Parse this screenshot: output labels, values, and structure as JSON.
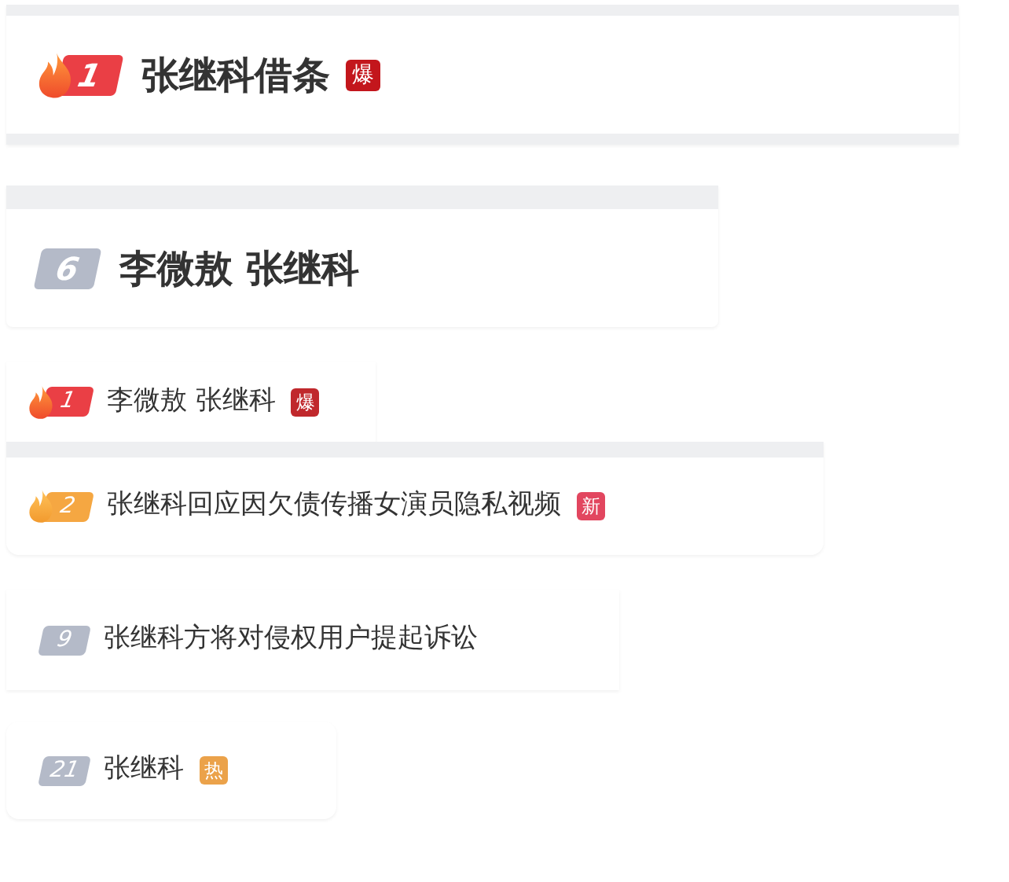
{
  "entries": [
    {
      "kind": "headline",
      "rank": {
        "text": "1",
        "color": "#ea3f45",
        "flame": true
      },
      "title": "张继科借条",
      "tag": {
        "text": "爆",
        "color": "#c3161c"
      }
    },
    {
      "kind": "headline",
      "rank": {
        "text": "6",
        "color": "#b4bac8",
        "flame": false
      },
      "title": "李微敖 张继科"
    },
    {
      "kind": "list",
      "rank": {
        "text": "1",
        "color": "#ea3f45",
        "flame": true
      },
      "title": "李微敖 张继科",
      "tag": {
        "text": "爆",
        "color": "#c0282c"
      }
    },
    {
      "kind": "list",
      "rank": {
        "text": "2",
        "color": "#f5a742",
        "flame": true
      },
      "title": "张继科回应因欠债传播女演员隐私视频",
      "tag": {
        "text": "新",
        "color": "#e2465f"
      }
    },
    {
      "kind": "list",
      "rank": {
        "text": "9",
        "color": "#b4bac8",
        "flame": false
      },
      "title": "张继科方将对侵权用户提起诉讼"
    },
    {
      "kind": "list",
      "rank": {
        "text": "21",
        "color": "#b4bac8",
        "flame": false
      },
      "title": "张继科",
      "tag": {
        "text": "热",
        "color": "#eba24a"
      }
    }
  ]
}
